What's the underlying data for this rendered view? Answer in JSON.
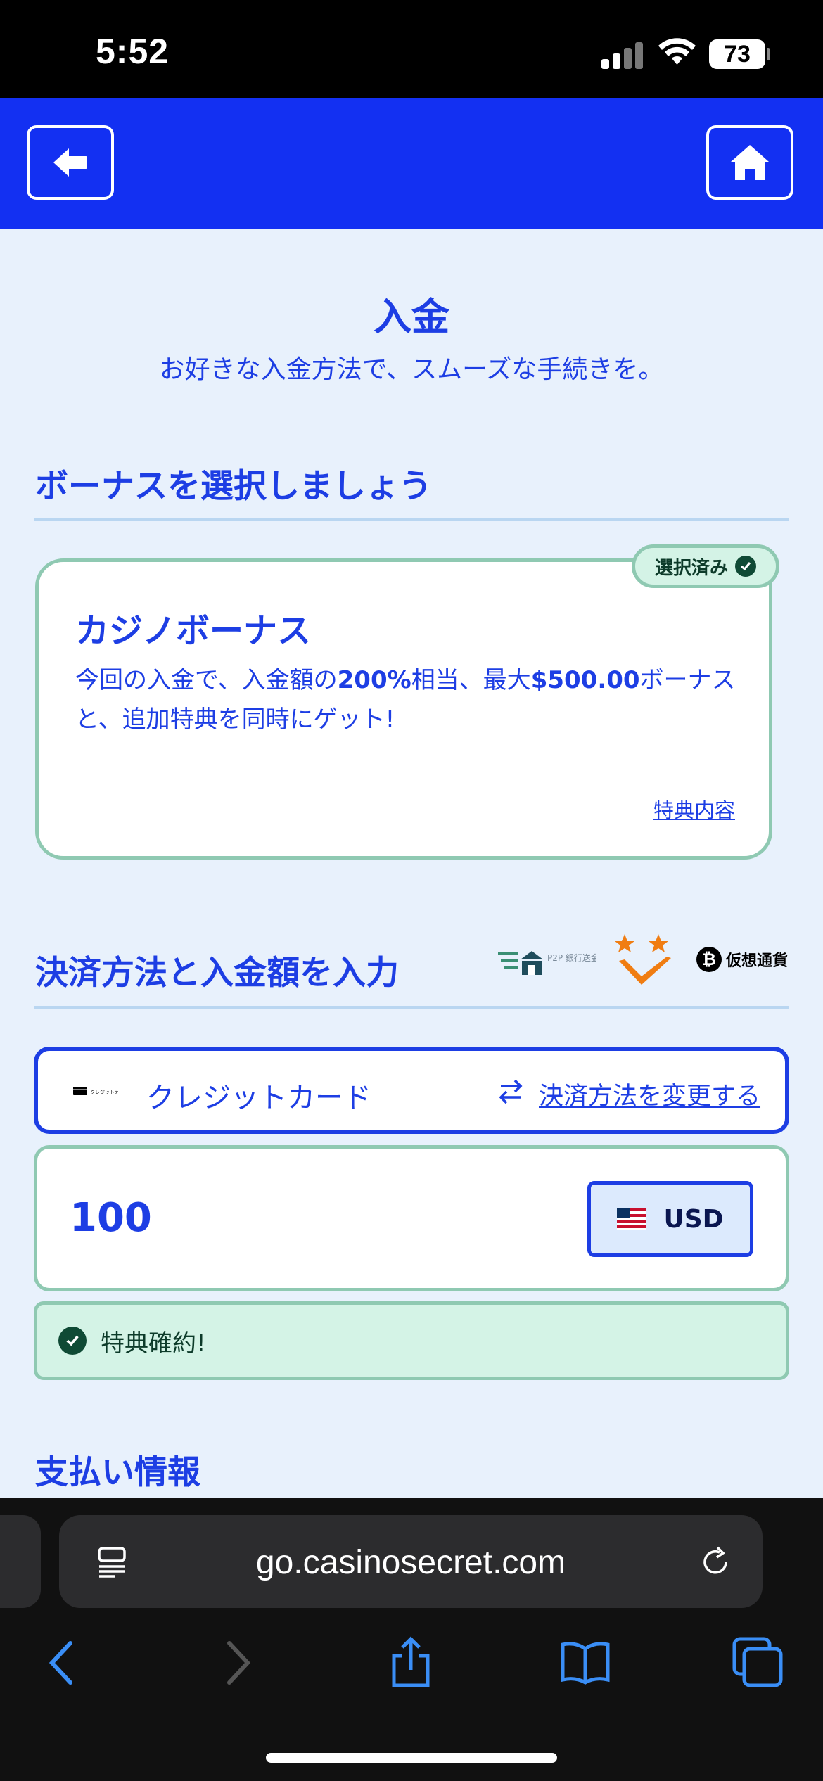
{
  "status_bar": {
    "time": "5:52",
    "battery": "73"
  },
  "header": {
    "back_icon": "arrow-left-icon",
    "home_icon": "home-icon"
  },
  "page": {
    "title": "入金",
    "subtitle": "お好きな入金方法で、スムーズな手続きを。"
  },
  "bonus_section": {
    "heading": "ボーナスを選択しましょう",
    "badge": "選択済み",
    "card_title": "カジノボーナス",
    "desc_part1": "今回の入金で、入金額の",
    "desc_percent": "200%",
    "desc_part2": "相当、最大",
    "desc_amount": "$500.00",
    "desc_part3": "ボーナスと、追加特典を同時にゲット!",
    "details_link": "特典内容"
  },
  "payment_section": {
    "heading": "決済方法と入金額を入力",
    "logos": {
      "p2p": "P2P 銀行送金",
      "crypto": "仮想通貨"
    },
    "card_mini_label": "クレジットカード",
    "method_name": "クレジットカード",
    "change_link": "決済方法を変更する",
    "amount": "100",
    "currency": "USD",
    "status": "特典確約!"
  },
  "payment_info": {
    "heading": "支払い情報"
  },
  "browser": {
    "url": "go.casinosecret.com"
  },
  "colors": {
    "brand_blue": "#1330f2",
    "text_blue": "#1d3ee4",
    "mint": "#8fc9b2",
    "mint_bg": "#d4f3e6"
  }
}
